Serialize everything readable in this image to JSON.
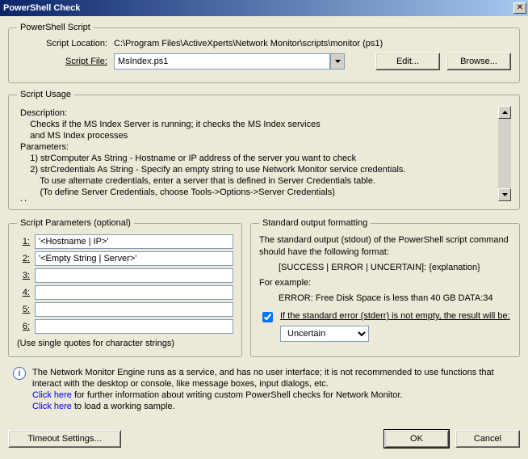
{
  "window": {
    "title": "PowerShell Check",
    "close": "✕"
  },
  "script_group": {
    "legend": "PowerShell Script",
    "location_label": "Script Location:",
    "location_value": "C:\\Program Files\\ActiveXperts\\Network Monitor\\scripts\\monitor (ps1)",
    "file_label": "Script File:",
    "file_value": "MsIndex.ps1",
    "edit_btn": "Edit...",
    "browse_btn": "Browse..."
  },
  "usage_group": {
    "legend": "Script Usage",
    "lines": [
      "Description:",
      "    Checks if the MS Index Server is running; it checks the MS Index services",
      "    and MS Index processes",
      "Parameters:",
      "    1) strComputer As String - Hostname or IP address of the server you want to check",
      "    2) strCredentials As String - Specify an empty string to use Network Monitor service credentials.",
      "        To use alternate credentials, enter a server that is defined in Server Credentials table.",
      "        (To define Server Credentials, choose Tools->Options->Server Credentials)",
      "Usage:"
    ]
  },
  "params_group": {
    "legend": "Script Parameters (optional)",
    "rows": [
      {
        "label": "1:",
        "value": "'<Hostname | IP>'"
      },
      {
        "label": "2:",
        "value": "'<Empty String | Server>'"
      },
      {
        "label": "3:",
        "value": ""
      },
      {
        "label": "4:",
        "value": ""
      },
      {
        "label": "5:",
        "value": ""
      },
      {
        "label": "6:",
        "value": ""
      }
    ],
    "hint": "(Use single quotes for character strings)"
  },
  "std_group": {
    "legend": "Standard output formatting",
    "line1": "The standard output (stdout) of the PowerShell script command should have the following format:",
    "line2": "[SUCCESS | ERROR | UNCERTAIN]: {explanation}",
    "line3": "For example:",
    "line4": "ERROR: Free Disk Space is less than 40 GB DATA:34",
    "checkbox_label": "If the standard error (stderr) is not empty, the result will be:",
    "select_value": "Uncertain"
  },
  "notes": {
    "service_text": "The Network Monitor Engine runs as a service, and has no user interface; it is not recommended to use functions that interact with the desktop or console, like message boxes, input dialogs, etc.",
    "link1_text": "Click here",
    "link1_rest": " for further information about writing custom PowerShell checks for Network Monitor.",
    "link2_text": "Click here",
    "link2_rest": " to load a working sample."
  },
  "buttons": {
    "timeout": "Timeout Settings...",
    "ok": "OK",
    "cancel": "Cancel"
  }
}
